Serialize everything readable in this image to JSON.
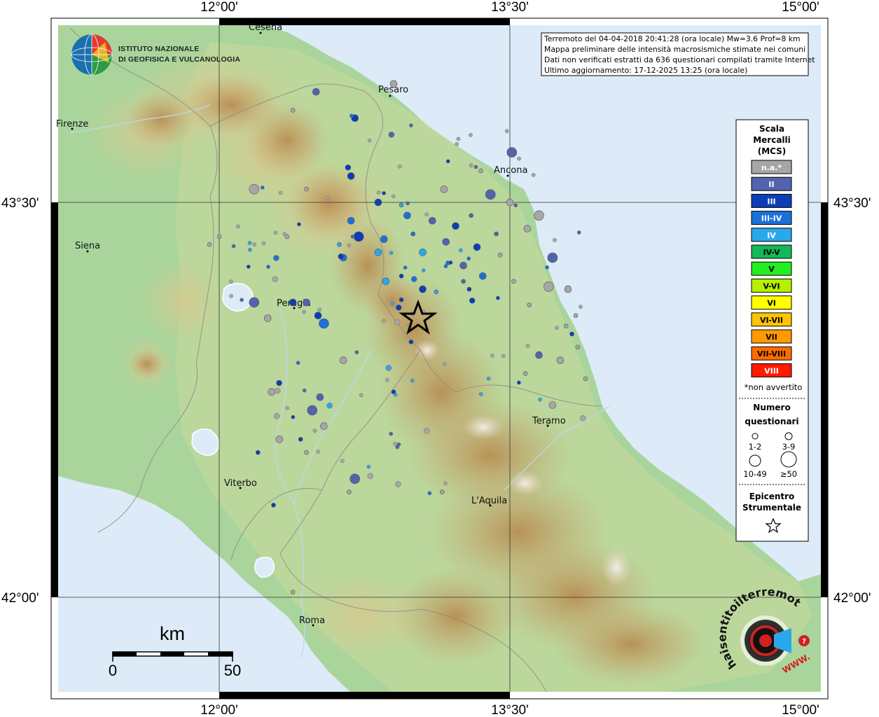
{
  "coordinates": {
    "top": [
      "12°00'",
      "13°30'",
      "15°00'"
    ],
    "bottom": [
      "12°00'",
      "13°30'",
      "15°00'"
    ],
    "left": [
      "43°30'",
      "42°00'"
    ],
    "right": [
      "43°30'",
      "42°00'"
    ]
  },
  "header": {
    "logo_line1": "ISTITUTO NAZIONALE",
    "logo_line2": "DI GEOFISICA E VULCANOLOGIA"
  },
  "info_box": {
    "line1": "Terremoto del 04-04-2018 20:41:28 (ora locale) Mw=3.6 Prof=8 km",
    "line2": "Mappa preliminare delle intensità macrosismiche stimate nei comuni",
    "line3": "Dati non verificati estratti da 636 questionari compilati tramite Internet",
    "line4": "Ultimo aggiornamento: 17-12-2025 13:25 (ora locale)"
  },
  "cities": [
    {
      "name": "Cesena"
    },
    {
      "name": "Pesaro"
    },
    {
      "name": "Firenze"
    },
    {
      "name": "Ancona"
    },
    {
      "name": "Siena"
    },
    {
      "name": "Perugia"
    },
    {
      "name": "Teramo"
    },
    {
      "name": "Viterbo"
    },
    {
      "name": "L'Aquila"
    },
    {
      "name": "Roma"
    }
  ],
  "legend": {
    "title_line1": "Scala",
    "title_line2": "Mercalli",
    "title_line3": "(MCS)",
    "classes": [
      {
        "label": "n.a.*",
        "color": "#a6a6a6",
        "text_color": "#ffffff"
      },
      {
        "label": "II",
        "color": "#5364ae",
        "text_color": "#ffffff"
      },
      {
        "label": "III",
        "color": "#0b3fb5",
        "text_color": "#ffffff"
      },
      {
        "label": "III-IV",
        "color": "#1c71d9",
        "text_color": "#ffffff"
      },
      {
        "label": "IV",
        "color": "#2aa8ec",
        "text_color": "#ffffff"
      },
      {
        "label": "IV-V",
        "color": "#11b957",
        "text_color": "#000000"
      },
      {
        "label": "V",
        "color": "#22ee22",
        "text_color": "#000000"
      },
      {
        "label": "V-VI",
        "color": "#b4f000",
        "text_color": "#000000"
      },
      {
        "label": "VI",
        "color": "#ffff00",
        "text_color": "#000000"
      },
      {
        "label": "VI-VII",
        "color": "#ffc400",
        "text_color": "#000000"
      },
      {
        "label": "VII",
        "color": "#ff9a00",
        "text_color": "#000000"
      },
      {
        "label": "VII-VIII",
        "color": "#ff6a00",
        "text_color": "#000000"
      },
      {
        "label": "VIII",
        "color": "#ff1a00",
        "text_color": "#ffffff"
      }
    ],
    "not_felt_note": "*non avvertito",
    "count_title_line1": "Numero",
    "count_title_line2": "questionari",
    "count_sizes": [
      "1-2",
      "3-9",
      "10-49",
      "≥50"
    ],
    "epicenter_line1": "Epicentro",
    "epicenter_line2": "Strumentale"
  },
  "scale_bar": {
    "unit": "km",
    "start": "0",
    "end": "50"
  },
  "haisentito": {
    "text": "haisentitoilterremoto.it",
    "www": "WWW."
  },
  "colors": {
    "sea": "#dcebf7",
    "lowland": "#a7d49a",
    "hill": "#d9d39c",
    "mountain": "#c79a59",
    "epicenter": "#000000"
  },
  "observations": [
    {
      "lon": 12.9,
      "lat": 43.95,
      "mcs": "n.a.",
      "count": "3-9"
    },
    {
      "lon": 12.5,
      "lat": 43.92,
      "mcs": "II",
      "count": "3-9"
    },
    {
      "lon": 12.7,
      "lat": 43.82,
      "mcs": "III",
      "count": "3-9"
    },
    {
      "lon": 12.38,
      "lat": 43.85,
      "mcs": "n.a.",
      "count": "1-2"
    },
    {
      "lon": 12.45,
      "lat": 43.55,
      "mcs": "n.a.",
      "count": "1-2"
    },
    {
      "lon": 12.68,
      "lat": 43.6,
      "mcs": "III",
      "count": "3-9"
    },
    {
      "lon": 12.82,
      "lat": 43.5,
      "mcs": "III",
      "count": "3-9"
    },
    {
      "lon": 12.94,
      "lat": 43.49,
      "mcs": "IV",
      "count": "1-2"
    },
    {
      "lon": 12.97,
      "lat": 43.45,
      "mcs": "III-IV",
      "count": "3-9"
    },
    {
      "lon": 12.68,
      "lat": 43.43,
      "mcs": "III-IV",
      "count": "3-9"
    },
    {
      "lon": 12.72,
      "lat": 43.37,
      "mcs": "III",
      "count": "10-49"
    },
    {
      "lon": 12.85,
      "lat": 43.36,
      "mcs": "III-IV",
      "count": "3-9"
    },
    {
      "lon": 12.62,
      "lat": 43.34,
      "mcs": "IV",
      "count": "1-2"
    },
    {
      "lon": 13.05,
      "lat": 43.31,
      "mcs": "IV",
      "count": "3-9"
    },
    {
      "lon": 12.82,
      "lat": 43.31,
      "mcs": "IV",
      "count": "3-9"
    },
    {
      "lon": 12.64,
      "lat": 43.29,
      "mcs": "III-IV",
      "count": "3-9"
    },
    {
      "lon": 13.17,
      "lat": 43.35,
      "mcs": "II",
      "count": "3-9"
    },
    {
      "lon": 13.26,
      "lat": 43.26,
      "mcs": "II",
      "count": "3-9"
    },
    {
      "lon": 12.86,
      "lat": 43.2,
      "mcs": "IV",
      "count": "3-9"
    },
    {
      "lon": 12.94,
      "lat": 43.22,
      "mcs": "III",
      "count": "1-2"
    },
    {
      "lon": 13.05,
      "lat": 43.17,
      "mcs": "III",
      "count": "3-9"
    },
    {
      "lon": 12.38,
      "lat": 43.12,
      "mcs": "III",
      "count": "3-9"
    },
    {
      "lon": 12.45,
      "lat": 43.12,
      "mcs": "II",
      "count": "3-9"
    },
    {
      "lon": 12.51,
      "lat": 43.07,
      "mcs": "III",
      "count": "3-9"
    },
    {
      "lon": 12.54,
      "lat": 43.04,
      "mcs": "III-IV",
      "count": "10-49"
    },
    {
      "lon": 12.94,
      "lat": 43.13,
      "mcs": "III",
      "count": "1-2"
    },
    {
      "lon": 12.18,
      "lat": 43.12,
      "mcs": "II",
      "count": "10-49"
    },
    {
      "lon": 12.25,
      "lat": 43.06,
      "mcs": "n.a.",
      "count": "3-9"
    },
    {
      "lon": 12.64,
      "lat": 42.9,
      "mcs": "n.a.",
      "count": "3-9"
    },
    {
      "lon": 12.52,
      "lat": 42.76,
      "mcs": "II",
      "count": "3-9"
    },
    {
      "lon": 12.48,
      "lat": 42.71,
      "mcs": "II",
      "count": "10-49"
    },
    {
      "lon": 12.31,
      "lat": 42.6,
      "mcs": "n.a.",
      "count": "3-9"
    },
    {
      "lon": 12.7,
      "lat": 42.45,
      "mcs": "II",
      "count": "10-49"
    },
    {
      "lon": 13.4,
      "lat": 43.53,
      "mcs": "II",
      "count": "10-49"
    },
    {
      "lon": 13.65,
      "lat": 43.45,
      "mcs": "n.a.",
      "count": "10-49"
    },
    {
      "lon": 13.72,
      "lat": 43.29,
      "mcs": "II",
      "count": "10-49"
    },
    {
      "lon": 13.7,
      "lat": 43.18,
      "mcs": "n.a.",
      "count": "10-49"
    },
    {
      "lon": 13.65,
      "lat": 42.92,
      "mcs": "II",
      "count": "3-9"
    },
    {
      "lon": 13.72,
      "lat": 42.73,
      "mcs": "n.a.",
      "count": "3-9"
    },
    {
      "lon": 13.51,
      "lat": 43.69,
      "mcs": "II",
      "count": "10-49"
    },
    {
      "lon": 13.5,
      "lat": 43.5,
      "mcs": "n.a.",
      "count": "3-9"
    },
    {
      "lon": 13.3,
      "lat": 43.45,
      "mcs": "II",
      "count": "1-2"
    },
    {
      "lon": 13.22,
      "lat": 43.41,
      "mcs": "III",
      "count": "3-9"
    },
    {
      "lon": 13.1,
      "lat": 43.43,
      "mcs": "II",
      "count": "3-9"
    },
    {
      "lon": 13.0,
      "lat": 43.38,
      "mcs": "III-IV",
      "count": "1-2"
    },
    {
      "lon": 13.33,
      "lat": 43.33,
      "mcs": "III",
      "count": "3-9"
    },
    {
      "lon": 13.45,
      "lat": 43.3,
      "mcs": "n.a.",
      "count": "1-2"
    },
    {
      "lon": 13.18,
      "lat": 43.27,
      "mcs": "III-IV",
      "count": "1-2"
    },
    {
      "lon": 13.36,
      "lat": 43.22,
      "mcs": "III-IV",
      "count": "3-9"
    },
    {
      "lon": 13.26,
      "lat": 43.2,
      "mcs": "II",
      "count": "1-2"
    },
    {
      "lon": 13.52,
      "lat": 43.2,
      "mcs": "n.a.",
      "count": "1-2"
    },
    {
      "lon": 13.29,
      "lat": 43.17,
      "mcs": "III",
      "count": "1-2"
    },
    {
      "lon": 13.12,
      "lat": 43.16,
      "mcs": "IV",
      "count": "1-2"
    },
    {
      "lon": 13.6,
      "lat": 43.11,
      "mcs": "n.a.",
      "count": "1-2"
    },
    {
      "lon": 13.8,
      "lat": 43.17,
      "mcs": "n.a.",
      "count": "3-9"
    },
    {
      "lon": 13.84,
      "lat": 43.07,
      "mcs": "n.a.",
      "count": "1-2"
    },
    {
      "lon": 13.82,
      "lat": 43.0,
      "mcs": "III",
      "count": "1-2"
    },
    {
      "lon": 13.85,
      "lat": 42.95,
      "mcs": "n.a.",
      "count": "1-2"
    },
    {
      "lon": 13.76,
      "lat": 42.9,
      "mcs": "n.a.",
      "count": "3-9"
    },
    {
      "lon": 13.89,
      "lat": 42.83,
      "mcs": "n.a.",
      "count": "1-2"
    },
    {
      "lon": 13.58,
      "lat": 42.85,
      "mcs": "n.a.",
      "count": "1-2"
    },
    {
      "lon": 12.99,
      "lat": 42.97,
      "mcs": "III",
      "count": "1-2"
    },
    {
      "lon": 12.9,
      "lat": 42.78,
      "mcs": "III",
      "count": "1-2"
    },
    {
      "lon": 12.42,
      "lat": 42.6,
      "mcs": "III",
      "count": "1-2"
    },
    {
      "lon": 12.27,
      "lat": 42.78,
      "mcs": "n.a.",
      "count": "3-9"
    },
    {
      "lon": 12.2,
      "lat": 42.55,
      "mcs": "III",
      "count": "1-2"
    },
    {
      "lon": 12.54,
      "lat": 42.65,
      "mcs": "n.a.",
      "count": "3-9"
    },
    {
      "lon": 12.45,
      "lat": 42.55,
      "mcs": "n.a.",
      "count": "1-2"
    },
    {
      "lon": 12.28,
      "lat": 42.35,
      "mcs": "III",
      "count": "1-2"
    },
    {
      "lon": 12.38,
      "lat": 42.02,
      "mcs": "n.a.",
      "count": "1-2"
    },
    {
      "lon": 12.67,
      "lat": 42.4,
      "mcs": "n.a.",
      "count": "1-2"
    },
    {
      "lon": 13.15,
      "lat": 42.4,
      "mcs": "n.a.",
      "count": "1-2"
    },
    {
      "lon": 12.0,
      "lat": 43.37,
      "mcs": "n.a.",
      "count": "1-2"
    },
    {
      "lon": 11.95,
      "lat": 43.34,
      "mcs": "n.a.",
      "count": "1-2"
    },
    {
      "lon": 12.35,
      "lat": 43.37,
      "mcs": "n.a.",
      "count": "1-2"
    },
    {
      "lon": 12.18,
      "lat": 43.55,
      "mcs": "n.a.",
      "count": "10-49"
    },
    {
      "lon": 13.35,
      "lat": 43.62,
      "mcs": "n.a.",
      "count": "1-2"
    },
    {
      "lon": 13.43,
      "lat": 43.38,
      "mcs": "II",
      "count": "1-2"
    },
    {
      "lon": 13.16,
      "lat": 43.55,
      "mcs": "n.a.",
      "count": "3-9"
    },
    {
      "lon": 13.59,
      "lat": 43.4,
      "mcs": "n.a.",
      "count": "3-9"
    },
    {
      "lon": 13.79,
      "lat": 43.03,
      "mcs": "n.a.",
      "count": "1-2"
    }
  ]
}
